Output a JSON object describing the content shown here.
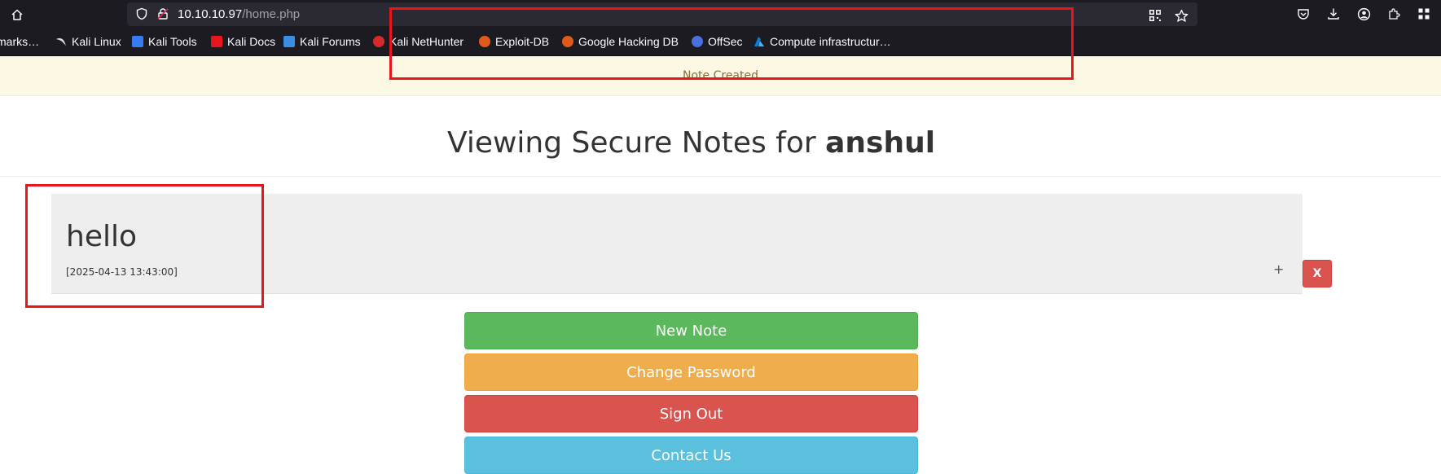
{
  "browser": {
    "url_host": "10.10.10.97",
    "url_path": "/home.php",
    "bookmarks": [
      {
        "label": "marks…",
        "icon": "none"
      },
      {
        "label": "Kali Linux",
        "icon": "kali-dragon-icon"
      },
      {
        "label": "Kali Tools",
        "icon": "kali-tools-icon"
      },
      {
        "label": "Kali Docs",
        "icon": "kali-docs-icon"
      },
      {
        "label": "Kali Forums",
        "icon": "kali-forums-icon"
      },
      {
        "label": "Kali NetHunter",
        "icon": "nethunter-icon"
      },
      {
        "label": "Exploit-DB",
        "icon": "exploit-db-icon"
      },
      {
        "label": "Google Hacking DB",
        "icon": "ghdb-icon"
      },
      {
        "label": "OffSec",
        "icon": "offsec-icon"
      },
      {
        "label": "Compute infrastructur…",
        "icon": "azure-icon"
      }
    ]
  },
  "alert": {
    "text": "Note Created"
  },
  "header": {
    "title_prefix": "Viewing Secure Notes for ",
    "username": "anshul"
  },
  "note": {
    "title": "hello",
    "timestamp": "[2025-04-13 13:43:00]",
    "expand_label": "+",
    "delete_label": "X"
  },
  "actions": {
    "new_note": "New Note",
    "change_password": "Change Password",
    "sign_out": "Sign Out",
    "contact_us": "Contact Us"
  },
  "colors": {
    "alert_bg": "#fcf8e3",
    "success": "#5cb85c",
    "warning": "#f0ad4e",
    "danger": "#d9534f",
    "info": "#5bc0de",
    "annotation_red": "#e8161c"
  }
}
